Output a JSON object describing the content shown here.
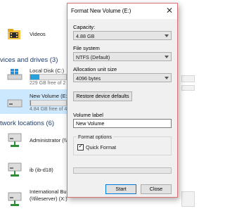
{
  "explorer": {
    "quick_access": {
      "videos_label": "Videos"
    },
    "devices_section": {
      "chevron": "⌄",
      "label": "vices and drives (3)"
    },
    "drives": [
      {
        "name": "Local Disk (C:)",
        "free_text": "229 GB free of 2",
        "used_fraction": 0.25,
        "icon": "windows-drive-icon"
      },
      {
        "name": "New Volume (E:)",
        "free_text": "4.84 GB free of 4",
        "used_fraction": 0.02,
        "icon": "drive-icon"
      }
    ],
    "network_section": {
      "chevron": "⌄",
      "label": "twork locations (6)"
    },
    "network_locations": [
      {
        "name": "Administrator (\\\\",
        "icon": "network-drive-icon"
      },
      {
        "name": "ib (ib-d18)",
        "icon": "network-drive-icon"
      },
      {
        "name": "International Bu",
        "sub": "(\\\\fileserver) (X:)",
        "icon": "network-drive-icon"
      }
    ]
  },
  "dialog": {
    "title": "Format New Volume (E:)",
    "close_glyph": "✕",
    "capacity_label": "Capacity:",
    "capacity_value": "4.88 GB",
    "filesystem_label": "File system",
    "filesystem_value": "NTFS (Default)",
    "allocation_label": "Allocation unit size",
    "allocation_value": "4096 bytes",
    "restore_button": "Restore device defaults",
    "volume_label_label": "Volume label",
    "volume_label_value": "New Volume",
    "format_options_label": "Format options",
    "quick_format_label": "Quick Format",
    "quick_format_checked": true,
    "progress_fraction": 0,
    "start_button": "Start",
    "close_button": "Close"
  },
  "colors": {
    "accent": "#0078d7",
    "selection": "#cce8ff",
    "capacity_fill": "#26a0da",
    "dialog_border": "#d87373"
  }
}
